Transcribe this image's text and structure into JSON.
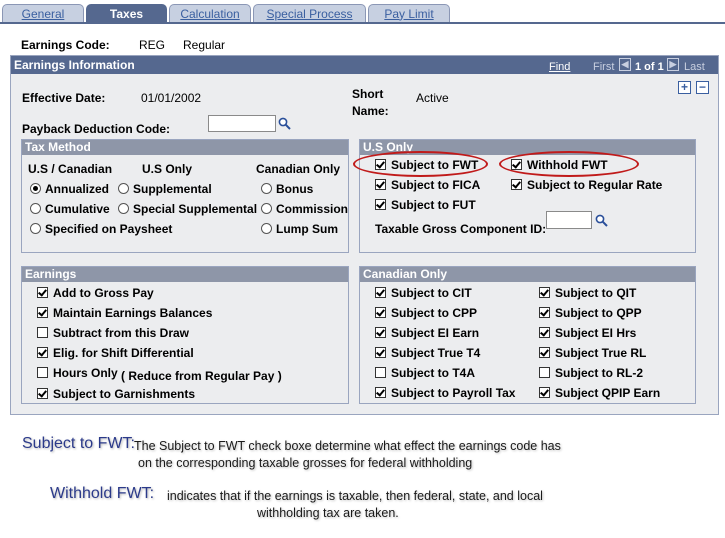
{
  "tabs": [
    "General",
    "Taxes",
    "Calculation",
    "Special Process",
    "Pay Limit"
  ],
  "earnings_code": {
    "label": "Earnings Code:",
    "code": "REG",
    "description": "Regular"
  },
  "group": {
    "title": "Earnings Information",
    "find": "Find",
    "first": "First",
    "page_of": "1 of 1",
    "last": "Last"
  },
  "effective_date": {
    "label": "Effective Date:",
    "value": "01/01/2002"
  },
  "short_name": {
    "label_line1": "Short",
    "label_line2": "Name:",
    "value": "Active"
  },
  "payback": {
    "label": "Payback Deduction Code:",
    "value": ""
  },
  "tax_method": {
    "title": "Tax Method",
    "col1": "U.S / Canadian",
    "col2": "U.S Only",
    "col3": "Canadian Only",
    "opt_annualized": "Annualized",
    "opt_cumulative": "Cumulative",
    "opt_specified": "Specified on Paysheet",
    "opt_supplemental": "Supplemental",
    "opt_special_supplemental": "Special Supplemental",
    "opt_bonus": "Bonus",
    "opt_commission": "Commission",
    "opt_lump_sum": "Lump Sum"
  },
  "us_only": {
    "title": "U.S Only",
    "subject_fwt": "Subject to FWT",
    "withhold_fwt": "Withhold FWT",
    "subject_fica": "Subject to FICA",
    "subject_regular_rate": "Subject to Regular Rate",
    "subject_fut": "Subject to FUT",
    "taxable_gross_label": "Taxable Gross Component ID:",
    "taxable_gross_value": ""
  },
  "earnings": {
    "title": "Earnings",
    "add_gross": "Add to Gross Pay",
    "maintain_balances": "Maintain Earnings Balances",
    "subtract_draw": "Subtract from this Draw",
    "elig_shift": "Elig. for Shift Differential",
    "hours_only": "Hours Only",
    "reduce_note": "( Reduce from Regular Pay )",
    "garnishments": "Subject to Garnishments"
  },
  "canadian_only": {
    "title": "Canadian Only",
    "cit": "Subject to CIT",
    "cpp": "Subject to CPP",
    "ei_earn": "Subject EI Earn",
    "true_t4": "Subject True T4",
    "t4a": "Subject to T4A",
    "payroll_tax": "Subject to Payroll Tax",
    "qit": "Subject to QIT",
    "qpp": "Subject to QPP",
    "ei_hrs": "Subject EI Hrs",
    "true_rl": "Subject True RL",
    "rl2": "Subject to RL-2",
    "qpip": "Subject QPIP Earn"
  },
  "notes": {
    "fwt_head": "Subject to FWT:",
    "fwt_line1": "The Subject to FWT check boxe determine what effect the earnings code has",
    "fwt_line2": "on the corresponding taxable grosses for federal withholding",
    "withhold_head": "Withhold FWT:",
    "withhold_line1": " indicates that if the earnings is taxable, then federal, state, and local",
    "withhold_line2": "withholding tax are taken."
  },
  "colors": {
    "header": "#55688f",
    "tab": "#c7d0e1",
    "highlight_oval": "#c01a1a"
  }
}
